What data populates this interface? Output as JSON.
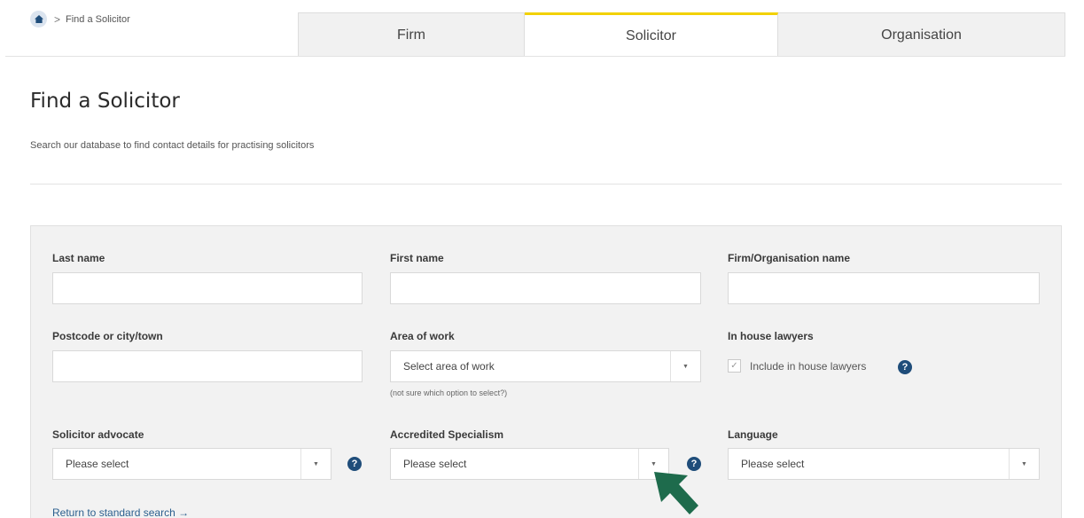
{
  "breadcrumb": {
    "separator": ">",
    "current": "Find a Solicitor"
  },
  "tabs": [
    {
      "label": "Firm",
      "active": false
    },
    {
      "label": "Solicitor",
      "active": true
    },
    {
      "label": "Organisation",
      "active": false
    }
  ],
  "page": {
    "title": "Find a Solicitor",
    "subtitle": "Search our database to find contact details for practising solicitors"
  },
  "form": {
    "last_name": {
      "label": "Last name",
      "value": ""
    },
    "first_name": {
      "label": "First name",
      "value": ""
    },
    "firm_name": {
      "label": "Firm/Organisation name",
      "value": ""
    },
    "postcode": {
      "label": "Postcode or city/town",
      "value": ""
    },
    "area_of_work": {
      "label": "Area of work",
      "selected": "Select area of work",
      "hint": "(not sure which option to select?)"
    },
    "in_house": {
      "label": "In house lawyers",
      "checkbox_label": "Include in house lawyers",
      "checked": true
    },
    "solicitor_advocate": {
      "label": "Solicitor advocate",
      "selected": "Please select"
    },
    "accredited_specialism": {
      "label": "Accredited Specialism",
      "selected": "Please select"
    },
    "language": {
      "label": "Language",
      "selected": "Please select"
    },
    "return_link": "Return to standard search →"
  },
  "icons": {
    "help": "?",
    "dropdown": "▼",
    "check": "✓"
  },
  "colors": {
    "active_tab_accent": "#f2d100",
    "help_icon": "#1f4d7a",
    "link": "#2b5f8e",
    "annotation_arrow": "#1e6b4c"
  }
}
